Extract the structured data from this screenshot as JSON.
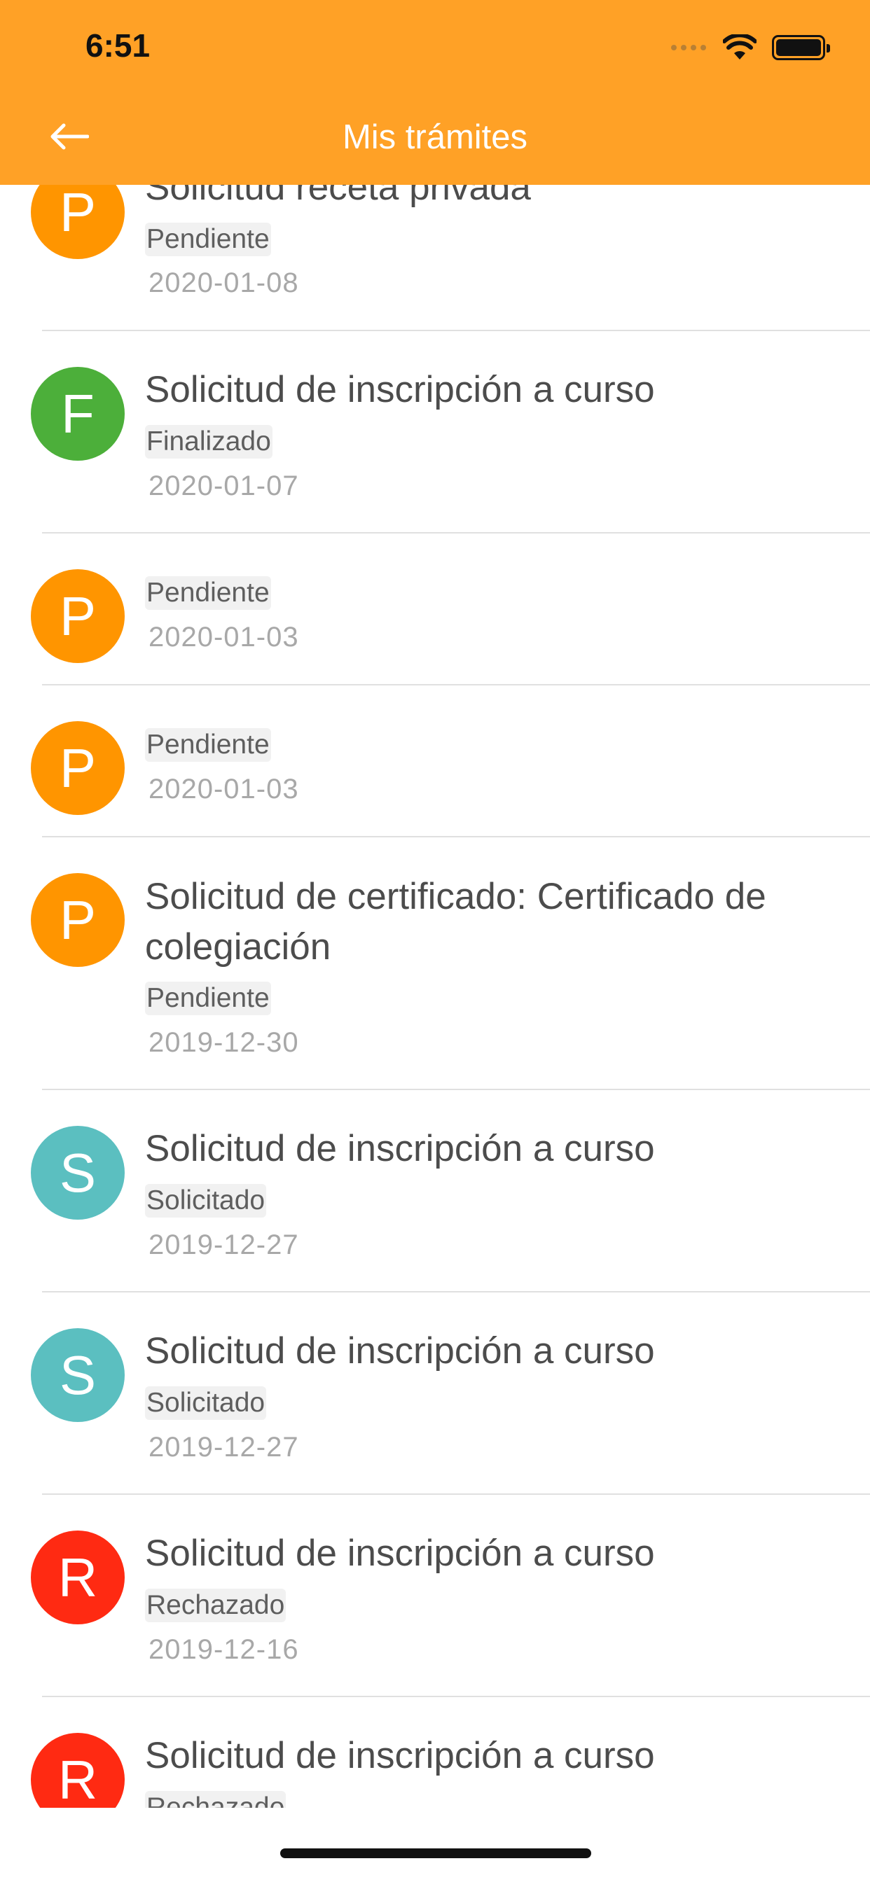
{
  "status_bar": {
    "time": "6:51"
  },
  "nav": {
    "title": "Mis trámites"
  },
  "items": [
    {
      "initial": "P",
      "color": "#FF9500",
      "title": "Solicitud receta privada",
      "status": "Pendiente",
      "date": "2020-01-08"
    },
    {
      "initial": "F",
      "color": "#4CAF3A",
      "title": "Solicitud de inscripción a curso",
      "status": "Finalizado",
      "date": "2020-01-07"
    },
    {
      "initial": "P",
      "color": "#FF9500",
      "title": "",
      "status": "Pendiente",
      "date": "2020-01-03"
    },
    {
      "initial": "P",
      "color": "#FF9500",
      "title": "",
      "status": "Pendiente",
      "date": "2020-01-03"
    },
    {
      "initial": "P",
      "color": "#FF9500",
      "title": "Solicitud de certificado: Certificado de colegiación",
      "status": "Pendiente",
      "date": "2019-12-30"
    },
    {
      "initial": "S",
      "color": "#5BBFC0",
      "title": "Solicitud de inscripción a curso",
      "status": "Solicitado",
      "date": "2019-12-27"
    },
    {
      "initial": "S",
      "color": "#5BBFC0",
      "title": "Solicitud de inscripción a curso",
      "status": "Solicitado",
      "date": "2019-12-27"
    },
    {
      "initial": "R",
      "color": "#FF2A12",
      "title": "Solicitud de inscripción a curso",
      "status": "Rechazado",
      "date": "2019-12-16"
    },
    {
      "initial": "R",
      "color": "#FF2A12",
      "title": "Solicitud de inscripción a curso",
      "status": "Rechazado",
      "date": ""
    }
  ]
}
